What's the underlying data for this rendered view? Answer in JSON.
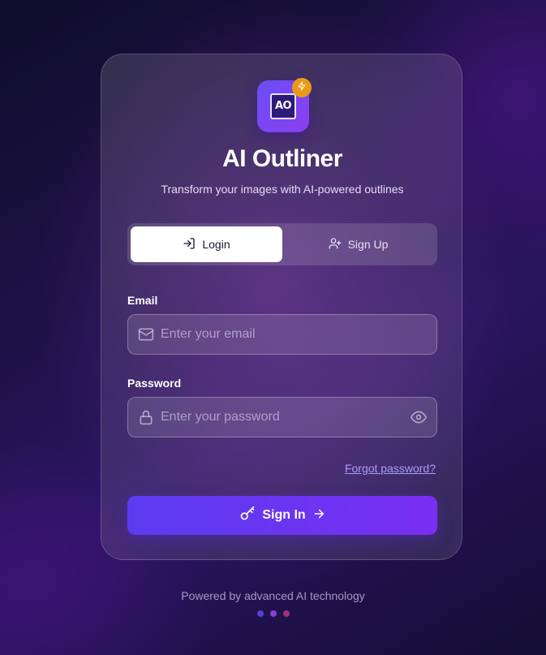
{
  "app": {
    "logo_text": "AO",
    "title": "AI Outliner",
    "subtitle": "Transform your images with AI-powered outlines"
  },
  "tabs": [
    {
      "label": "Login",
      "icon": "login-icon",
      "active": true
    },
    {
      "label": "Sign Up",
      "icon": "user-plus-icon",
      "active": false
    }
  ],
  "form": {
    "email": {
      "label": "Email",
      "placeholder": "Enter your email",
      "value": "",
      "icon": "mail-icon"
    },
    "password": {
      "label": "Password",
      "placeholder": "Enter your password",
      "value": "",
      "icon": "lock-icon",
      "toggle_icon": "eye-icon"
    },
    "forgot_label": "Forgot password?",
    "submit_label": "Sign In",
    "submit_icons": [
      "key-icon",
      "arrow-right-icon"
    ]
  },
  "footer": {
    "text": "Powered by advanced AI technology",
    "dots": [
      "#5b3fd6",
      "#8a3fd8",
      "#a0307a"
    ]
  },
  "colors": {
    "accent": "#6a3cf2",
    "badge": "#e89a1a",
    "link": "#a99cf8"
  }
}
